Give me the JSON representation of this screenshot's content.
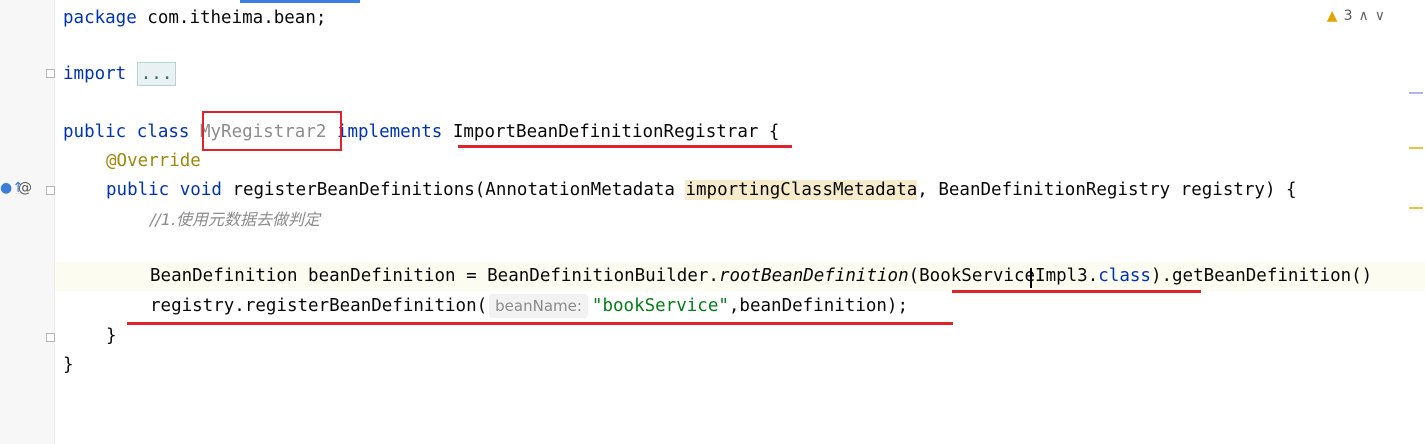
{
  "inspections": {
    "warning_count": "3",
    "warn_icon": "warning-triangle-icon",
    "up_icon": "chevron-up-icon",
    "down_icon": "chevron-down-icon"
  },
  "code": {
    "l1_kw": "package",
    "l1_rest": " com.itheima.bean;",
    "l3_kw": "import",
    "l3_fold": "...",
    "l5_kw": "public class ",
    "l5_class": "MyRegistrar2",
    "l5_impl": " implements ",
    "l5_iface": "ImportBeanDefinitionRegistrar",
    "l5_brace": " {",
    "l6_ann": "@Override",
    "l7_kw": "public void ",
    "l7_method": "registerBeanDefinitions(AnnotationMetadata ",
    "l7_param": "importingClassMetadata",
    "l7_rest": ", BeanDefinitionRegistry registry) {",
    "l8_comment": "//1.使用元数据去做判定",
    "l10_a": "BeanDefinition beanDefinition = BeanDefinitionBuilder.",
    "l10_b": "rootBeanDefinition",
    "l10_c": "(BookServiceImpl3.",
    "l10_d": "class",
    "l10_e": ").getBeanDefinition()",
    "l11_a": "registry.registerBeanDefinition(",
    "l11_hint": "beanName:",
    "l11_str": "\"bookService\"",
    "l11_b": ",beanDefinition);",
    "l12": "}",
    "l13": "}"
  }
}
